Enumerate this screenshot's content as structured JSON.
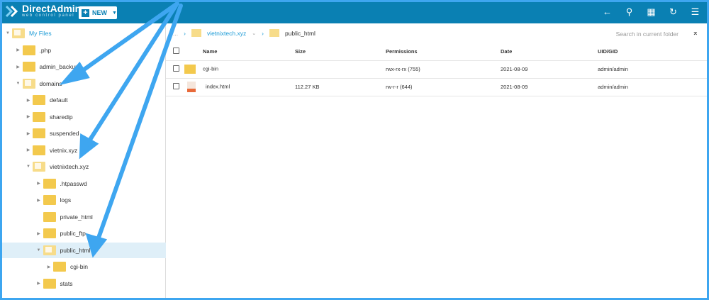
{
  "header": {
    "logo_title": "DirectAdmin",
    "logo_subtitle": "web control panel",
    "new_label": "NEW",
    "icons": [
      "back-arrow-icon",
      "search-icon",
      "grid-view-icon",
      "refresh-icon",
      "settings-sliders-icon"
    ]
  },
  "tree": [
    {
      "label": "My Files",
      "level": 0,
      "open": true,
      "root": true
    },
    {
      "label": ".php",
      "level": 1
    },
    {
      "label": "admin_backups",
      "level": 1
    },
    {
      "label": "domains",
      "level": 1,
      "open": true
    },
    {
      "label": "default",
      "level": 2
    },
    {
      "label": "sharedip",
      "level": 2
    },
    {
      "label": "suspended",
      "level": 2
    },
    {
      "label": "vietnix.xyz",
      "level": 2
    },
    {
      "label": "vietnixtech.xyz",
      "level": 2,
      "open": true
    },
    {
      "label": ".htpasswd",
      "level": 3
    },
    {
      "label": "logs",
      "level": 3
    },
    {
      "label": "private_html",
      "level": 3,
      "noarrow": true
    },
    {
      "label": "public_ftp",
      "level": 3
    },
    {
      "label": "public_html",
      "level": 3,
      "open": true,
      "selected": true
    },
    {
      "label": "cgi-bin",
      "level": 4
    },
    {
      "label": "stats",
      "level": 3
    }
  ],
  "breadcrumb": {
    "ellipsis": "...",
    "parent": "vietnixtech.xyz",
    "current": "public_html"
  },
  "search": {
    "placeholder": "Search in current folder"
  },
  "table": {
    "headers": [
      "Name",
      "Size",
      "Permissions",
      "Date",
      "UID/GID"
    ],
    "rows": [
      {
        "name": "cgi-bin",
        "type": "folder",
        "size": "",
        "permissions": "rwx-rx-rx (755)",
        "date": "2021-08-09",
        "uid": "admin/admin"
      },
      {
        "name": "index.html",
        "type": "html",
        "size": "112.27 KB",
        "permissions": "rw-r-r (644)",
        "date": "2021-08-09",
        "uid": "admin/admin"
      }
    ]
  },
  "colors": {
    "header": "#0a80b3",
    "accent": "#1a9ad6",
    "annotation_arrow": "#3ea6f0",
    "folder": "#f3c94d"
  }
}
